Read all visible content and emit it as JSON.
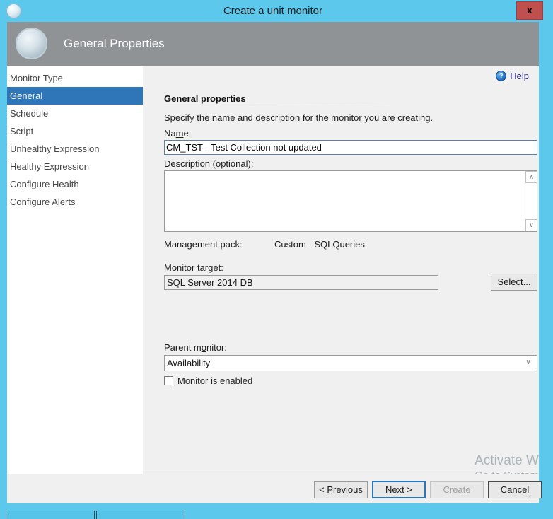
{
  "window": {
    "title": "Create a unit monitor",
    "close_label": "x",
    "title_icon": "circle-orb-icon"
  },
  "banner": {
    "title": "General Properties",
    "icon": "circle-orb-icon"
  },
  "sidebar": {
    "items": [
      {
        "label": "Monitor Type",
        "selected": false
      },
      {
        "label": "General",
        "selected": true
      },
      {
        "label": "Schedule",
        "selected": false
      },
      {
        "label": "Script",
        "selected": false
      },
      {
        "label": "Unhealthy Expression",
        "selected": false
      },
      {
        "label": "Healthy Expression",
        "selected": false
      },
      {
        "label": "Configure Health",
        "selected": false
      },
      {
        "label": "Configure Alerts",
        "selected": false
      }
    ]
  },
  "content": {
    "help_label": "Help",
    "help_icon": "question-mark-icon",
    "section_title": "General properties",
    "intro_text": "Specify the name and description for the monitor you are creating.",
    "name": {
      "label_pre": "Na",
      "label_acc": "m",
      "label_post": "e:",
      "value": "CM_TST - Test Collection not updated"
    },
    "description": {
      "label_acc": "D",
      "label_post": "escription (optional):",
      "value": "",
      "scroll_up": "∧",
      "scroll_down": "∨"
    },
    "management_pack": {
      "label": "Management pack:",
      "value": "Custom - SQLQueries"
    },
    "monitor_target": {
      "label_pre": "Monitor tar",
      "label_acc": "g",
      "label_post": "et:",
      "value": "SQL Server 2014 DB",
      "select_button_acc": "S",
      "select_button_post": "elect..."
    },
    "parent_monitor": {
      "label_pre": "Parent m",
      "label_acc": "o",
      "label_post": "nitor:",
      "value": "Availability",
      "chevron": "∨"
    },
    "monitor_enabled": {
      "label_pre": "Monitor is ena",
      "label_acc": "b",
      "label_post": "led",
      "checked": false
    }
  },
  "footer": {
    "previous_pre": "< ",
    "previous_acc": "P",
    "previous_post": "revious",
    "next_acc": "N",
    "next_post": "ext >",
    "create_label": "Create",
    "cancel_label": "Cancel",
    "resize_grip": "⸮"
  },
  "watermark": {
    "line1": "Activate W",
    "line2": "Go to System"
  },
  "colors": {
    "window_border": "#5BC8EC",
    "banner": "#909396",
    "accent_selected": "#2E76B8",
    "close_button": "#c0504d",
    "dialog_bg": "#f0f0f0"
  }
}
